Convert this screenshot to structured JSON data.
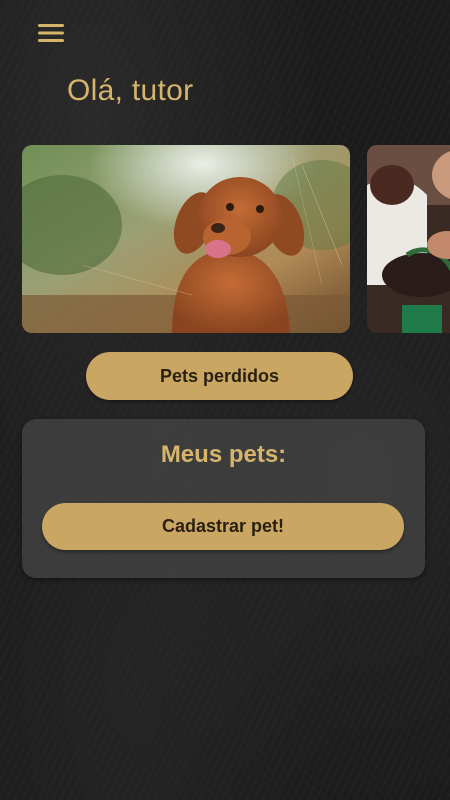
{
  "header": {
    "menu_icon": "hamburger-menu-icon",
    "greeting": "Olá, tutor"
  },
  "carousel": {
    "slides": [
      {
        "image": "dog-photo"
      },
      {
        "image": "person-with-pet-photo"
      }
    ]
  },
  "actions": {
    "lost_pets_label": "Pets perdidos"
  },
  "my_pets": {
    "title": "Meus pets:",
    "register_label": "Cadastrar pet!"
  },
  "colors": {
    "accent": "#c9a763",
    "title_text": "#d6b46c",
    "button_text": "#2a1f10",
    "background": "#1b1b1b",
    "card_background": "#464646"
  }
}
